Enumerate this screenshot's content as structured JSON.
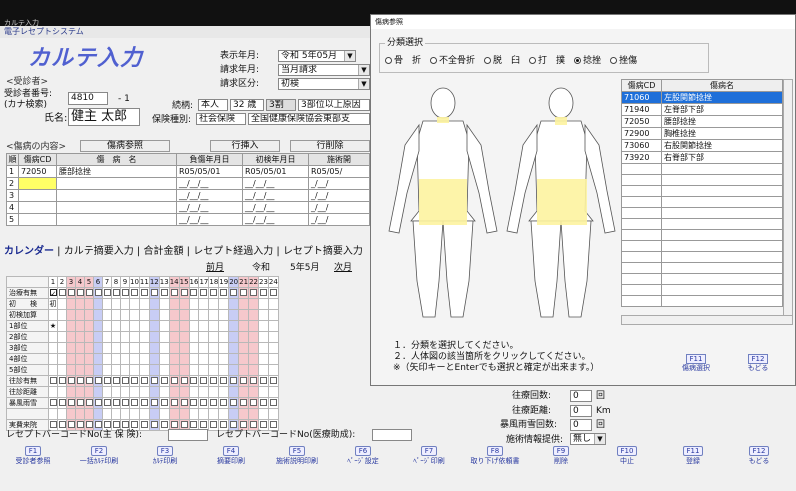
{
  "app": {
    "window_title": "カルテ入力",
    "system_name": "電子レセプトシステム",
    "title": "カルテ入力"
  },
  "patient": {
    "section": "<受診者>",
    "id_label": "受診者番号:",
    "kana_label": "(カナ検索)",
    "name_label": "氏名:",
    "id_value": "4810",
    "id_branch": "- 1",
    "name_value": "健主 太郎",
    "relation_label": "続柄:",
    "relation": "本人",
    "age": "32 歳",
    "ratio": "3割",
    "category": "3部位以上原因",
    "insurance_label": "保険種別:",
    "insurance": "社会保険",
    "insurer": "全国健康保険協会東部支"
  },
  "header": {
    "display_month_label": "表示年月:",
    "display_month": "令和 5年05月",
    "claim_month_label": "請求年月:",
    "claim_month": "当月請求",
    "claim_type_label": "請求区分:",
    "claim_type": "初検"
  },
  "injury": {
    "section": "<傷病の内容>",
    "ref_button": "傷病参照",
    "insert_button": "行挿入",
    "delete_button": "行削除",
    "columns": [
      "順",
      "傷病CD",
      "傷　病　名",
      "負傷年月日",
      "初検年月日",
      "施術開"
    ],
    "rows": [
      {
        "no": "1",
        "code": "72050",
        "name": "腰部捻挫",
        "injury_date": "R05/05/01",
        "first_date": "R05/05/01",
        "start": "R05/05/"
      },
      {
        "no": "2",
        "code": "",
        "name": "",
        "injury_date": "__/__/__",
        "first_date": "__/__/__",
        "start": "_/__/"
      },
      {
        "no": "3",
        "code": "",
        "name": "",
        "injury_date": "__/__/__",
        "first_date": "__/__/__",
        "start": "_/__/"
      },
      {
        "no": "4",
        "code": "",
        "name": "",
        "injury_date": "__/__/__",
        "first_date": "__/__/__",
        "start": "_/__/"
      },
      {
        "no": "5",
        "code": "",
        "name": "",
        "injury_date": "__/__/__",
        "first_date": "__/__/__",
        "start": "_/__/"
      }
    ]
  },
  "tabs": [
    "カレンダー",
    "カルテ摘要入力",
    "合計金額",
    "レセプト経過入力",
    "レセプト摘要入力"
  ],
  "calendar": {
    "prev": "前月",
    "era": "令和",
    "month": "5年5月",
    "next": "次月",
    "days": [
      "1",
      "2",
      "3",
      "4",
      "5",
      "6",
      "7",
      "8",
      "9",
      "10",
      "11",
      "12",
      "13",
      "14",
      "15",
      "16",
      "17",
      "18",
      "19",
      "20",
      "21",
      "22",
      "23",
      "24"
    ],
    "rows": [
      "治療有無",
      "初　　検",
      "初検加算",
      "1部位",
      "2部位",
      "3部位",
      "4部位",
      "5部位",
      "往診有無",
      "往診距離",
      "暴風雨雪",
      "",
      "実費来院"
    ],
    "first_visit_mark": "初",
    "region_star": "★"
  },
  "right_fields": {
    "visit_count_label": "往療回数:",
    "visit_count": "0",
    "visit_unit": "回",
    "visit_distance_label": "往療距離:",
    "visit_distance": "0",
    "distance_unit": "Km",
    "storm_label": "暴風雨雪回数:",
    "storm_count": "0",
    "storm_unit": "回",
    "info_label": "施術情報提供:",
    "info_value": "無し"
  },
  "barcode": {
    "main_label": "レセプトバーコードNo(主 保 険):",
    "sub_label": "レセプトバーコードNo(医療助成):"
  },
  "fkeys": [
    {
      "key": "F1",
      "label": "受診者参照"
    },
    {
      "key": "F2",
      "label": "一括ｶﾙﾃ印刷"
    },
    {
      "key": "F3",
      "label": "ｶﾙﾃ印刷"
    },
    {
      "key": "F4",
      "label": "摘要印刷"
    },
    {
      "key": "F5",
      "label": "施術説明印刷"
    },
    {
      "key": "F6",
      "label": "ﾍﾟｰｼﾞ設定"
    },
    {
      "key": "F7",
      "label": "ﾍﾟｰｼﾞ印刷"
    },
    {
      "key": "F8",
      "label": "取り下げ依頼書"
    },
    {
      "key": "F9",
      "label": "削除"
    },
    {
      "key": "F10",
      "label": "中止"
    },
    {
      "key": "F11",
      "label": "登録"
    },
    {
      "key": "F12",
      "label": "もどる"
    }
  ],
  "dialog": {
    "title": "傷病参照",
    "group_label": "分類選択",
    "radios": [
      "骨　折",
      "不全骨折",
      "脱　臼",
      "打　撲",
      "捻挫",
      "挫傷"
    ],
    "selected": 4,
    "list_headers": [
      "傷病CD",
      "傷病名"
    ],
    "list": [
      {
        "code": "71060",
        "name": "左股関節捻挫"
      },
      {
        "code": "71940",
        "name": "左脊部下部"
      },
      {
        "code": "72050",
        "name": "腰部捻挫"
      },
      {
        "code": "72900",
        "name": "胸椎捻挫"
      },
      {
        "code": "73060",
        "name": "右股関節捻挫"
      },
      {
        "code": "73920",
        "name": "右脊部下部"
      }
    ],
    "instructions": [
      "１．分類を選択してください。",
      "２．人体図の該当箇所をクリックしてください。",
      "※（矢印キーとEnterでも選択と確定が出来ます。）"
    ],
    "f11": {
      "key": "F11",
      "label": "傷病選択"
    },
    "f12": {
      "key": "F12",
      "label": "もどる"
    }
  },
  "colors": {
    "accent": "#1e6fd9",
    "title": "#5060d0",
    "weekend": "#f6c8cc",
    "blue_day": "#c8cdf5",
    "body_highlight": "#fdf3a0"
  }
}
